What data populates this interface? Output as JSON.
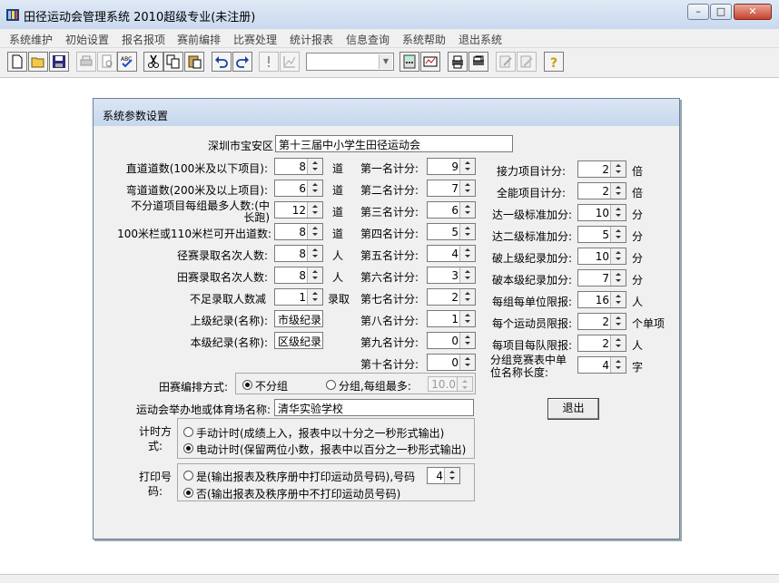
{
  "window": {
    "title": "田径运动会管理系统 2010超级专业(未注册)"
  },
  "menu": [
    "系统维护",
    "初始设置",
    "报名报项",
    "赛前编排",
    "比赛处理",
    "统计报表",
    "信息查询",
    "系统帮助",
    "退出系统"
  ],
  "toolbar": {
    "combo_value": ""
  },
  "dialog": {
    "title": "系统参数设置",
    "org_label": "深圳市宝安区",
    "meet_name": "第十三届中小学生田径运动会",
    "left": [
      {
        "label": "直道道数(100米及以下项目):",
        "value": "8",
        "unit": "道"
      },
      {
        "label": "弯道道数(200米及以上项目):",
        "value": "6",
        "unit": "道"
      },
      {
        "label": "不分道项目每组最多人数:(中长跑)",
        "value": "12",
        "unit": "道"
      },
      {
        "label": "100米栏或110米栏可开出道数:",
        "value": "8",
        "unit": "道"
      },
      {
        "label": "径赛录取名次人数:",
        "value": "8",
        "unit": "人"
      },
      {
        "label": "田赛录取名次人数:",
        "value": "8",
        "unit": "人"
      },
      {
        "label": "不足录取人数减",
        "value": "1",
        "unit": "录取"
      }
    ],
    "record_upper_label": "上级纪录(名称):",
    "record_upper_value": "市级纪录",
    "record_local_label": "本级纪录(名称):",
    "record_local_value": "区级纪录",
    "places": [
      {
        "label": "第一名计分:",
        "value": "9"
      },
      {
        "label": "第二名计分:",
        "value": "7"
      },
      {
        "label": "第三名计分:",
        "value": "6"
      },
      {
        "label": "第四名计分:",
        "value": "5"
      },
      {
        "label": "第五名计分:",
        "value": "4"
      },
      {
        "label": "第六名计分:",
        "value": "3"
      },
      {
        "label": "第七名计分:",
        "value": "2"
      },
      {
        "label": "第八名计分:",
        "value": "1"
      },
      {
        "label": "第九名计分:",
        "value": "0"
      },
      {
        "label": "第十名计分:",
        "value": "0"
      }
    ],
    "right": [
      {
        "label": "接力项目计分:",
        "value": "2",
        "unit": "倍"
      },
      {
        "label": "全能项目计分:",
        "value": "2",
        "unit": "倍"
      },
      {
        "label": "达一级标准加分:",
        "value": "10",
        "unit": "分"
      },
      {
        "label": "达二级标准加分:",
        "value": "5",
        "unit": "分"
      },
      {
        "label": "破上级纪录加分:",
        "value": "10",
        "unit": "分"
      },
      {
        "label": "破本级纪录加分:",
        "value": "7",
        "unit": "分"
      },
      {
        "label": "每组每单位限报:",
        "value": "16",
        "unit": "人"
      },
      {
        "label": "每个运动员限报:",
        "value": "2",
        "unit": "个单项"
      },
      {
        "label": "每项目每队限报:",
        "value": "2",
        "unit": "人"
      },
      {
        "label": "分组竞赛表中单位名称长度:",
        "value": "4",
        "unit": "字"
      }
    ],
    "field_mode_label": "田赛编排方式:",
    "field_mode_opt1": "不分组",
    "field_mode_opt2": "分组,每组最多:",
    "field_mode_value": "10.0",
    "venue_label": "运动会举办地或体育场名称:",
    "venue_value": "清华实验学校",
    "timing_label": "计时方式:",
    "timing_opt1": "手动计时(成绩上入，报表中以十分之一秒形式输出)",
    "timing_opt2": "电动计时(保留两位小数，报表中以百分之一秒形式输出)",
    "print_label": "打印号码:",
    "print_opt1": "是(输出报表及秩序册中打印运动员号码),号码",
    "print_value": "4",
    "print_opt2": "否(输出报表及秩序册中不打印运动员号码)",
    "exit_label": "退出"
  }
}
